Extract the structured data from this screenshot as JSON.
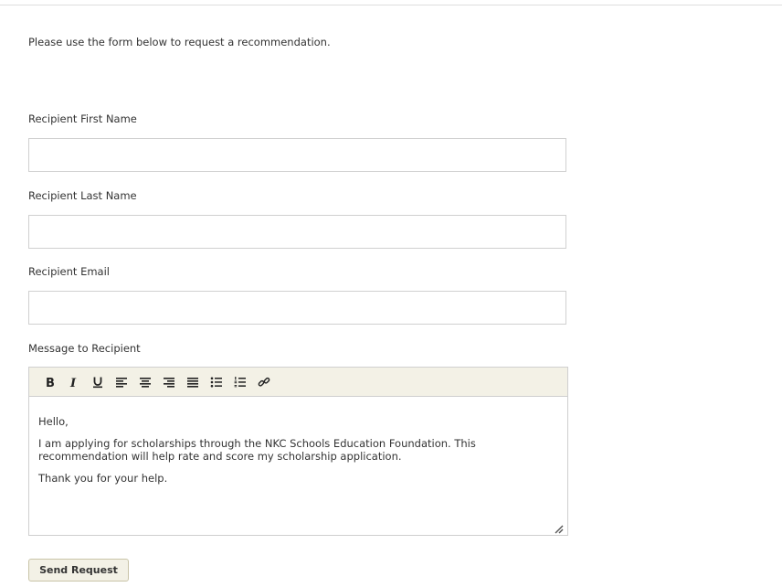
{
  "intro_text": "Please use the form below to request a recommendation.",
  "fields": {
    "first_name": {
      "label": "Recipient First Name",
      "value": "",
      "placeholder": ""
    },
    "last_name": {
      "label": "Recipient Last Name",
      "value": "",
      "placeholder": ""
    },
    "email": {
      "label": "Recipient Email",
      "value": "",
      "placeholder": ""
    }
  },
  "message": {
    "label": "Message to Recipient",
    "toolbar": [
      "bold-icon",
      "italic-icon",
      "underline-icon",
      "align-left-icon",
      "align-center-icon",
      "align-right-icon",
      "align-justify-icon",
      "bullet-list-icon",
      "numbered-list-icon",
      "link-icon"
    ],
    "paragraphs": [
      "Hello,",
      "I am applying for scholarships through the NKC Schools Education Foundation. This recommendation will help rate and score my scholarship application.",
      "Thank you for your help."
    ]
  },
  "send_button": {
    "label": "Send Request"
  },
  "colors": {
    "toolbar_bg": "#f3f1e6",
    "border": "#d0d0d0",
    "text": "#333333"
  }
}
